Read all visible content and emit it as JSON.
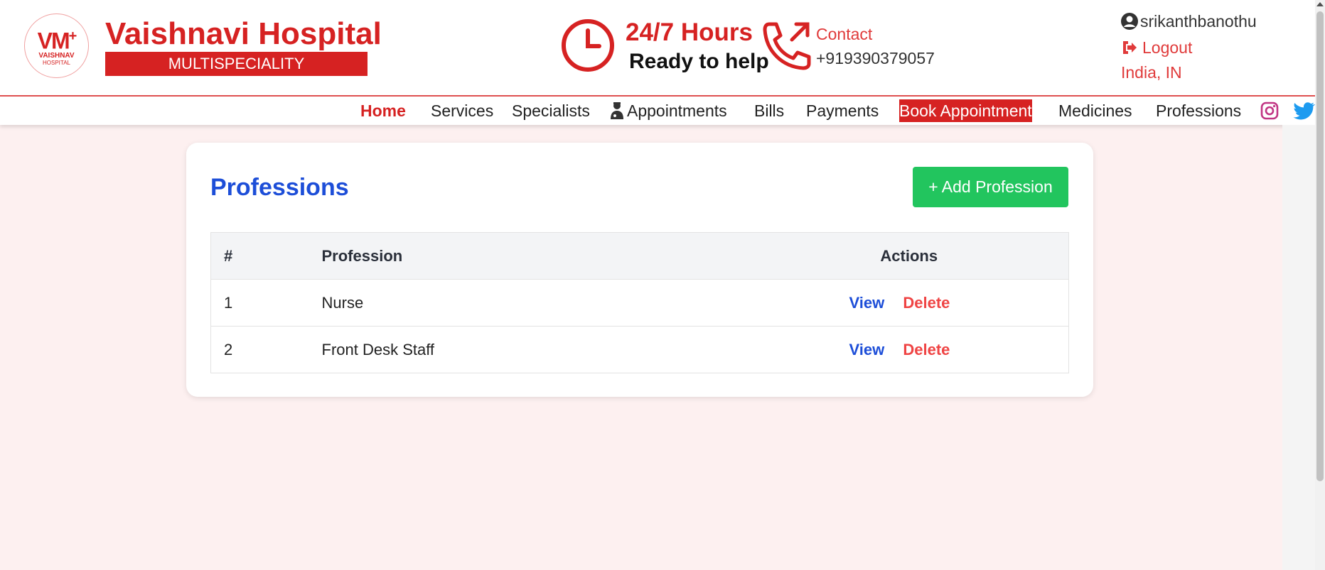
{
  "brand": {
    "logo_mark": "VM",
    "logo_line1": "VAISHNAV",
    "logo_line2": "HOSPITAL",
    "title": "Vaishnavi Hospital",
    "subtitle": "MULTISPECIALITY"
  },
  "hours": {
    "title": "24/7 Hours",
    "subtitle": "Ready to help"
  },
  "contact": {
    "label": "Contact",
    "phone": "+919390379057"
  },
  "user": {
    "username": "srikanthbanothu",
    "logout_label": "Logout",
    "locale": "India, IN"
  },
  "nav": {
    "items": [
      {
        "label": "Home"
      },
      {
        "label": "Services"
      },
      {
        "label": "Specialists"
      },
      {
        "label": "Appointments"
      },
      {
        "label": "Bills"
      },
      {
        "label": "Payments"
      },
      {
        "label": "Book Appointment"
      },
      {
        "label": "Medicines"
      },
      {
        "label": "Professions"
      }
    ],
    "social": [
      "instagram-icon",
      "twitter-icon"
    ]
  },
  "page": {
    "title": "Professions",
    "add_button": "+ Add Profession",
    "table": {
      "headers": [
        "#",
        "Profession",
        "Actions"
      ],
      "rows": [
        {
          "num": "1",
          "profession": "Nurse",
          "view": "View",
          "delete": "Delete"
        },
        {
          "num": "2",
          "profession": "Front Desk Staff",
          "view": "View",
          "delete": "Delete"
        }
      ]
    }
  },
  "colors": {
    "brand_red": "#d62222",
    "link_blue": "#1d4ed8",
    "add_green": "#22c55e",
    "delete_red": "#ef4444",
    "page_bg": "#fdf0f0"
  }
}
